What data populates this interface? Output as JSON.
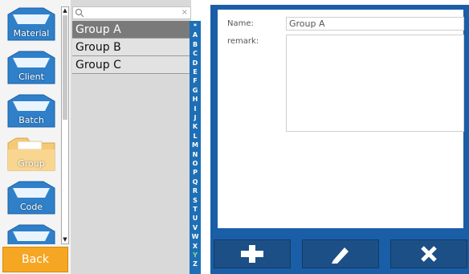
{
  "sidebar": {
    "items": [
      {
        "label": "Material",
        "icon": "material-folder-icon",
        "active": false
      },
      {
        "label": "Client",
        "icon": "client-folder-icon",
        "active": false
      },
      {
        "label": "Batch",
        "icon": "batch-folder-icon",
        "active": false
      },
      {
        "label": "Group",
        "icon": "group-folder-icon",
        "active": true
      },
      {
        "label": "Code",
        "icon": "code-folder-icon",
        "active": false
      },
      {
        "label": "",
        "icon": "more-folder-icon",
        "active": false
      }
    ],
    "back_label": "Back"
  },
  "search": {
    "value": "",
    "clear_symbol": "×"
  },
  "list": {
    "items": [
      "Group A",
      "Group B",
      "Group C"
    ],
    "selected": "Group A"
  },
  "alphabet": [
    "*",
    "A",
    "B",
    "C",
    "D",
    "E",
    "F",
    "G",
    "H",
    "I",
    "J",
    "K",
    "L",
    "M",
    "N",
    "O",
    "P",
    "Q",
    "R",
    "S",
    "T",
    "U",
    "V",
    "W",
    "X",
    "Y",
    "Z"
  ],
  "detail": {
    "name_label": "Name:",
    "name_value": "Group A",
    "remark_label": "remark:",
    "remark_value": ""
  },
  "actions": {
    "add_icon": "plus-icon",
    "edit_icon": "pencil-icon",
    "delete_icon": "close-icon"
  },
  "colors": {
    "accent_blue": "#1a5ea8",
    "back_orange": "#f5a623",
    "active_folder": "#f6c977",
    "folder_blue": "#2f80c9",
    "selected_item": "#7a7a7a"
  }
}
